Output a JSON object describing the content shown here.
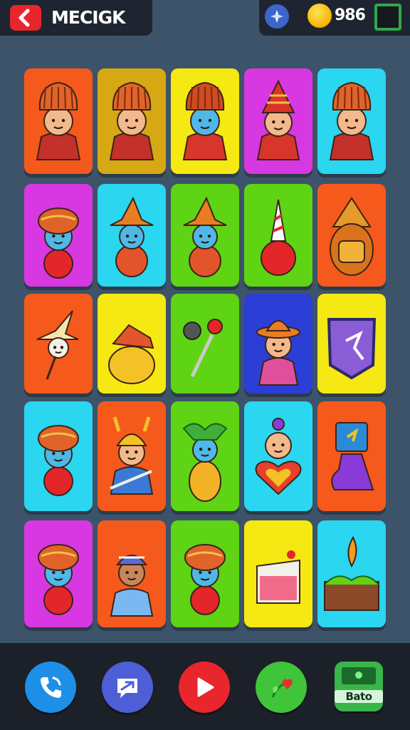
{
  "header": {
    "title": "MECIGK",
    "coin_count": "986"
  },
  "bottom_nav": {
    "shop_label": "Bato"
  },
  "colors": {
    "orange": "#f5591c",
    "mustard": "#d6a814",
    "yellow": "#f6e812",
    "magenta": "#d838e2",
    "cyan": "#2ad6f0",
    "green": "#5ed414",
    "blue": "#2b3fd6",
    "red": "#e8262c"
  },
  "tiles": [
    {
      "row": 1,
      "col": 1,
      "bg": "orange",
      "icon": "crowned-man-icon"
    },
    {
      "row": 1,
      "col": 2,
      "bg": "mustard",
      "icon": "crowned-man-icon"
    },
    {
      "row": 1,
      "col": 3,
      "bg": "yellow",
      "icon": "blue-crowned-man-icon"
    },
    {
      "row": 1,
      "col": 4,
      "bg": "magenta",
      "icon": "hat-man-icon"
    },
    {
      "row": 1,
      "col": 5,
      "bg": "cyan",
      "icon": "crowned-man-icon"
    },
    {
      "row": 2,
      "col": 1,
      "bg": "magenta",
      "icon": "turban-blue-man-icon"
    },
    {
      "row": 2,
      "col": 2,
      "bg": "cyan",
      "icon": "witch-hat-man-icon"
    },
    {
      "row": 2,
      "col": 3,
      "bg": "green",
      "icon": "witch-hat-man-icon"
    },
    {
      "row": 2,
      "col": 4,
      "bg": "green",
      "icon": "party-hat-ball-icon"
    },
    {
      "row": 2,
      "col": 5,
      "bg": "orange",
      "icon": "golden-mask-icon"
    },
    {
      "row": 3,
      "col": 1,
      "bg": "orange",
      "icon": "pointed-hat-face-icon"
    },
    {
      "row": 3,
      "col": 2,
      "bg": "yellow",
      "icon": "treasure-bag-icon"
    },
    {
      "row": 3,
      "col": 3,
      "bg": "green",
      "icon": "staff-icon"
    },
    {
      "row": 3,
      "col": 4,
      "bg": "blue",
      "icon": "sombrero-man-icon"
    },
    {
      "row": 3,
      "col": 5,
      "bg": "yellow",
      "icon": "shield-icon"
    },
    {
      "row": 4,
      "col": 1,
      "bg": "cyan",
      "icon": "turban-man-icon"
    },
    {
      "row": 4,
      "col": 2,
      "bg": "orange",
      "icon": "helmet-warrior-icon"
    },
    {
      "row": 4,
      "col": 3,
      "bg": "green",
      "icon": "leaf-hat-man-icon"
    },
    {
      "row": 4,
      "col": 4,
      "bg": "cyan",
      "icon": "heart-man-icon"
    },
    {
      "row": 4,
      "col": 5,
      "bg": "orange",
      "icon": "potion-bag-icon"
    },
    {
      "row": 5,
      "col": 1,
      "bg": "magenta",
      "icon": "turban-man-icon"
    },
    {
      "row": 5,
      "col": 2,
      "bg": "orange",
      "icon": "cap-boy-icon"
    },
    {
      "row": 5,
      "col": 3,
      "bg": "green",
      "icon": "turban-man-icon"
    },
    {
      "row": 5,
      "col": 4,
      "bg": "yellow",
      "icon": "cake-slice-icon"
    },
    {
      "row": 5,
      "col": 5,
      "bg": "cyan",
      "icon": "cake-candle-icon"
    }
  ]
}
